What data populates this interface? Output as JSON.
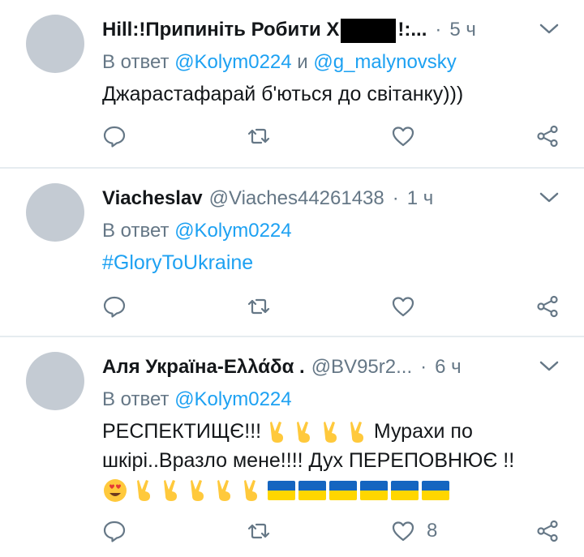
{
  "tweets": [
    {
      "name_prefix": "Hill:!Припиніть Робити Х",
      "name_suffix": "!:...",
      "dot": "·",
      "time": "5 ч",
      "reply_prefix": "В ответ",
      "reply_user1": "@Kolym0224",
      "reply_and": "и",
      "reply_user2": "@g_malynovsky",
      "text": "Джарастафарай б'ються до світанку)))"
    },
    {
      "name": "Viacheslav",
      "handle": "@Viaches44261438",
      "dot": "·",
      "time": "1 ч",
      "reply_prefix": "В ответ",
      "reply_user1": "@Kolym0224",
      "text": "#GloryToUkraine"
    },
    {
      "name": "Аля Україна-Ελλάδα .",
      "handle": "@BV95r2...",
      "dot": "·",
      "time": "6 ч",
      "reply_prefix": "В ответ",
      "reply_user1": "@Kolym0224",
      "text_line1_a": "РЕСПЕКТИЩЄ!!!",
      "text_line1_b": "Мурахи по",
      "text_line2": "шкірі..Вразло мене!!!! Дух ПЕРЕПОВНЮЄ !!",
      "like_count": "8"
    }
  ],
  "icons": {
    "reply": "reply-icon",
    "retweet": "retweet-icon",
    "like": "heart-icon",
    "share": "share-icon",
    "menu": "chevron-down-icon"
  },
  "colors": {
    "link": "#1da1f2",
    "muted": "#657786",
    "avatar": "#c4cbd3"
  }
}
